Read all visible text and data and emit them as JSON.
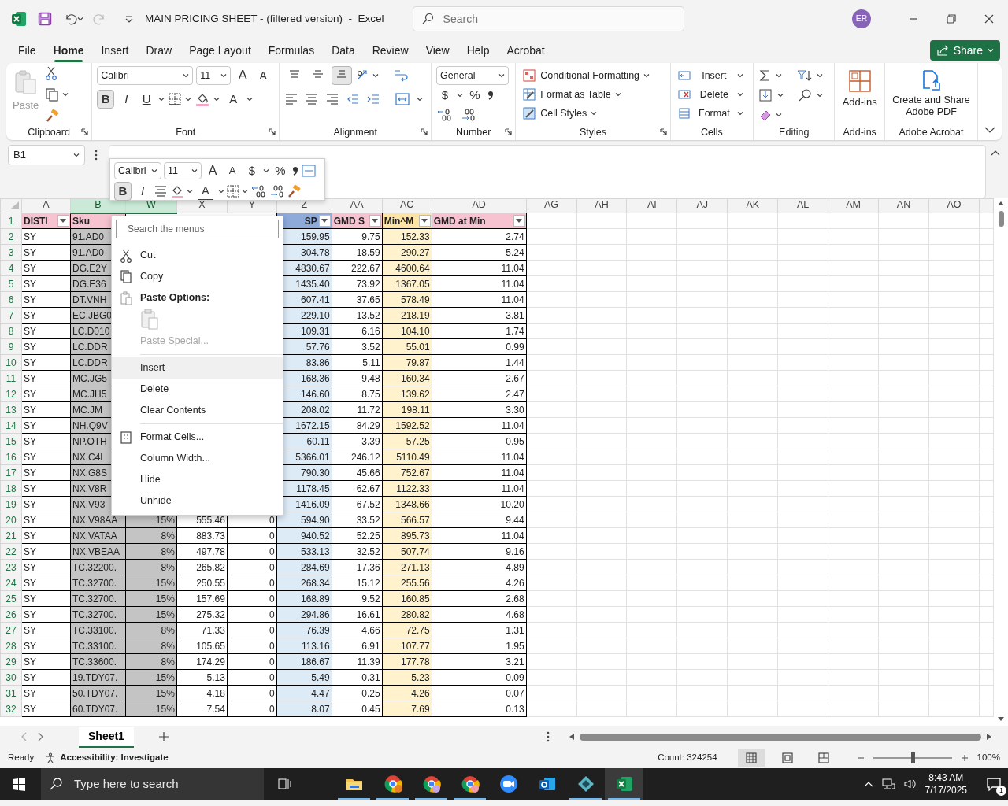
{
  "title_bar": {
    "title": "MAIN PRICING SHEET - (filtered version)  -  Excel",
    "search": {
      "placeholder": "Search"
    },
    "avatar": "ER"
  },
  "ribbon_tabs": [
    {
      "label": "File",
      "selected": false
    },
    {
      "label": "Home",
      "selected": true
    },
    {
      "label": "Insert",
      "selected": false
    },
    {
      "label": "Draw",
      "selected": false
    },
    {
      "label": "Page Layout",
      "selected": false
    },
    {
      "label": "Formulas",
      "selected": false
    },
    {
      "label": "Data",
      "selected": false
    },
    {
      "label": "Review",
      "selected": false
    },
    {
      "label": "View",
      "selected": false
    },
    {
      "label": "Help",
      "selected": false
    },
    {
      "label": "Acrobat",
      "selected": false
    }
  ],
  "share": "Share",
  "ribbon": {
    "clipboard": {
      "label": "Clipboard",
      "paste": "Paste",
      "paste_disabled": true
    },
    "font": {
      "label": "Font",
      "font": "Calibri",
      "size": "11",
      "grow": "A",
      "shrink": "A",
      "styles": [
        {
          "text": "B",
          "selected": true
        },
        {
          "text": "I",
          "selected": false
        },
        {
          "text": "U",
          "selected": false
        }
      ],
      "font_color": "A"
    },
    "alignment": {
      "label": "Alignment",
      "vertical": [
        {
          "selected": false
        },
        {
          "selected": false
        },
        {
          "selected": true
        }
      ]
    },
    "number": {
      "label": "Number",
      "format": "General",
      "currency": "$",
      "percent": "%"
    },
    "styles": {
      "label": "Styles",
      "items": [
        "Conditional Formatting",
        "Format as Table",
        "Cell Styles"
      ]
    },
    "cells": {
      "label": "Cells",
      "items": [
        "Insert",
        "Delete",
        "Format"
      ]
    },
    "editing": {
      "label": "Editing"
    },
    "addins": {
      "label": "Add-ins",
      "button": "Add-ins"
    },
    "acrobat": {
      "label": "Adobe Acrobat",
      "button": "Create and Share Adobe PDF"
    }
  },
  "formula_bar": {
    "name_box": "B1"
  },
  "mini_toolbar": {
    "font": "Calibri",
    "size": "11",
    "grow": "A",
    "shrink": "A",
    "currency": "$",
    "percent": "%",
    "bold": {
      "text": "B",
      "selected": true
    },
    "italic": {
      "text": "I",
      "selected": false
    },
    "font_color": "A"
  },
  "columns": [
    {
      "label": "A",
      "selected": false
    },
    {
      "label": "B",
      "selected": true
    },
    {
      "label": "W",
      "selected": true
    },
    {
      "label": "X",
      "selected": false
    },
    {
      "label": "Y",
      "selected": false
    },
    {
      "label": "Z",
      "selected": false,
      "color": "#ddebf7"
    },
    {
      "label": "AA",
      "selected": false
    },
    {
      "label": "AC",
      "selected": false,
      "color": "#fff2cc"
    },
    {
      "label": "AD",
      "selected": false
    },
    {
      "label": "AG",
      "selected": false
    },
    {
      "label": "AH",
      "selected": false
    },
    {
      "label": "AI",
      "selected": false
    },
    {
      "label": "AJ",
      "selected": false
    },
    {
      "label": "AK",
      "selected": false
    },
    {
      "label": "AL",
      "selected": false
    },
    {
      "label": "AM",
      "selected": false
    },
    {
      "label": "AN",
      "selected": false
    },
    {
      "label": "AO",
      "selected": false
    }
  ],
  "header_row": {
    "number": "1",
    "cells": [
      {
        "text": "DISTI",
        "color": "#f8c3d1",
        "filter": true
      },
      {
        "text": "Sku",
        "color": "#f8c3d1"
      },
      null,
      null,
      null,
      {
        "text": "SP",
        "color": "#8eaadb",
        "filter": true
      },
      {
        "text": "GMD S",
        "color": "#f8c3d1",
        "filter": true
      },
      {
        "text": "Min^M",
        "color": "#fde3a4",
        "filter": true
      },
      {
        "text": "GMD at Min",
        "color": "#f8c3d1",
        "filter": true
      }
    ]
  },
  "rows": [
    {
      "number": "2",
      "cells": [
        "SY",
        "91.AD0",
        null,
        null,
        null,
        "159.95",
        "9.75",
        "152.33",
        "2.74"
      ]
    },
    {
      "number": "3",
      "cells": [
        "SY",
        "91.AD0",
        null,
        null,
        null,
        "304.78",
        "18.59",
        "290.27",
        "5.24"
      ]
    },
    {
      "number": "4",
      "cells": [
        "SY",
        "DG.E2Y",
        null,
        null,
        null,
        "4830.67",
        "222.67",
        "4600.64",
        "11.04"
      ]
    },
    {
      "number": "5",
      "cells": [
        "SY",
        "DG.E36",
        null,
        null,
        null,
        "1435.40",
        "73.92",
        "1367.05",
        "11.04"
      ]
    },
    {
      "number": "6",
      "cells": [
        "SY",
        "DT.VNH",
        null,
        null,
        null,
        "607.41",
        "37.65",
        "578.49",
        "11.04"
      ]
    },
    {
      "number": "7",
      "cells": [
        "SY",
        "EC.JBG0",
        null,
        null,
        null,
        "229.10",
        "13.52",
        "218.19",
        "3.81"
      ]
    },
    {
      "number": "8",
      "cells": [
        "SY",
        "LC.D010",
        null,
        null,
        null,
        "109.31",
        "6.16",
        "104.10",
        "1.74"
      ]
    },
    {
      "number": "9",
      "cells": [
        "SY",
        "LC.DDR",
        null,
        null,
        null,
        "57.76",
        "3.52",
        "55.01",
        "0.99"
      ]
    },
    {
      "number": "10",
      "cells": [
        "SY",
        "LC.DDR",
        null,
        null,
        null,
        "83.86",
        "5.11",
        "79.87",
        "1.44"
      ]
    },
    {
      "number": "11",
      "cells": [
        "SY",
        "MC.JG5",
        null,
        null,
        null,
        "168.36",
        "9.48",
        "160.34",
        "2.67"
      ]
    },
    {
      "number": "12",
      "cells": [
        "SY",
        "MC.JH5",
        null,
        null,
        null,
        "146.60",
        "8.75",
        "139.62",
        "2.47"
      ]
    },
    {
      "number": "13",
      "cells": [
        "SY",
        "MC.JM",
        null,
        null,
        null,
        "208.02",
        "11.72",
        "198.11",
        "3.30"
      ]
    },
    {
      "number": "14",
      "cells": [
        "SY",
        "NH.Q9V",
        null,
        null,
        null,
        "1672.15",
        "84.29",
        "1592.52",
        "11.04"
      ]
    },
    {
      "number": "15",
      "cells": [
        "SY",
        "NP.OTH",
        null,
        null,
        null,
        "60.11",
        "3.39",
        "57.25",
        "0.95"
      ]
    },
    {
      "number": "16",
      "cells": [
        "SY",
        "NX.C4L",
        null,
        null,
        null,
        "5366.01",
        "246.12",
        "5110.49",
        "11.04"
      ]
    },
    {
      "number": "17",
      "cells": [
        "SY",
        "NX.G8S",
        null,
        null,
        null,
        "790.30",
        "45.66",
        "752.67",
        "11.04"
      ]
    },
    {
      "number": "18",
      "cells": [
        "SY",
        "NX.V8R",
        null,
        null,
        null,
        "1178.45",
        "62.67",
        "1122.33",
        "11.04"
      ]
    },
    {
      "number": "19",
      "cells": [
        "SY",
        "NX.V93",
        null,
        null,
        null,
        "1416.09",
        "67.52",
        "1348.66",
        "10.20"
      ]
    },
    {
      "number": "20",
      "cells": [
        "SY",
        "NX.V98AA",
        "15%",
        "555.46",
        "0",
        "594.90",
        "33.52",
        "566.57",
        "9.44"
      ]
    },
    {
      "number": "21",
      "cells": [
        "SY",
        "NX.VATAA",
        "8%",
        "883.73",
        "0",
        "940.52",
        "52.25",
        "895.73",
        "11.04"
      ]
    },
    {
      "number": "22",
      "cells": [
        "SY",
        "NX.VBEAA",
        "8%",
        "497.78",
        "0",
        "533.13",
        "32.52",
        "507.74",
        "9.16"
      ]
    },
    {
      "number": "23",
      "cells": [
        "SY",
        "TC.32200.",
        "8%",
        "265.82",
        "0",
        "284.69",
        "17.36",
        "271.13",
        "4.89"
      ]
    },
    {
      "number": "24",
      "cells": [
        "SY",
        "TC.32700.",
        "15%",
        "250.55",
        "0",
        "268.34",
        "15.12",
        "255.56",
        "4.26"
      ]
    },
    {
      "number": "25",
      "cells": [
        "SY",
        "TC.32700.",
        "15%",
        "157.69",
        "0",
        "168.89",
        "9.52",
        "160.85",
        "2.68"
      ]
    },
    {
      "number": "26",
      "cells": [
        "SY",
        "TC.32700.",
        "15%",
        "275.32",
        "0",
        "294.86",
        "16.61",
        "280.82",
        "4.68"
      ]
    },
    {
      "number": "27",
      "cells": [
        "SY",
        "TC.33100.",
        "8%",
        "71.33",
        "0",
        "76.39",
        "4.66",
        "72.75",
        "1.31"
      ]
    },
    {
      "number": "28",
      "cells": [
        "SY",
        "TC.33100.",
        "8%",
        "105.65",
        "0",
        "113.16",
        "6.91",
        "107.77",
        "1.95"
      ]
    },
    {
      "number": "29",
      "cells": [
        "SY",
        "TC.33600.",
        "8%",
        "174.29",
        "0",
        "186.67",
        "11.39",
        "177.78",
        "3.21"
      ]
    },
    {
      "number": "30",
      "cells": [
        "SY",
        "19.TDY07.",
        "15%",
        "5.13",
        "0",
        "5.49",
        "0.31",
        "5.23",
        "0.09"
      ]
    },
    {
      "number": "31",
      "cells": [
        "SY",
        "50.TDY07.",
        "15%",
        "4.18",
        "0",
        "4.47",
        "0.25",
        "4.26",
        "0.07"
      ]
    },
    {
      "number": "32",
      "cells": [
        "SY",
        "60.TDY07.",
        "15%",
        "7.54",
        "0",
        "8.07",
        "0.45",
        "7.69",
        "0.13"
      ]
    }
  ],
  "context_menu": {
    "search": {
      "placeholder": "Search the menus"
    },
    "items": [
      {
        "kind": "item",
        "label": "Cut",
        "selected": false,
        "disabled": false
      },
      {
        "kind": "item",
        "label": "Copy",
        "selected": false,
        "disabled": false
      },
      {
        "kind": "heading",
        "label": "Paste Options:"
      },
      {
        "kind": "paste",
        "disabled": true
      },
      {
        "kind": "item",
        "label": "Paste Special...",
        "selected": false,
        "disabled": true
      },
      {
        "kind": "separator"
      },
      {
        "kind": "item",
        "label": "Insert",
        "selected": true,
        "disabled": false
      },
      {
        "kind": "item",
        "label": "Delete",
        "selected": false,
        "disabled": false
      },
      {
        "kind": "item",
        "label": "Clear Contents",
        "selected": false,
        "disabled": false
      },
      {
        "kind": "separator"
      },
      {
        "kind": "item",
        "label": "Format Cells...",
        "selected": false,
        "disabled": false
      },
      {
        "kind": "item",
        "label": "Column Width...",
        "selected": false,
        "disabled": false
      },
      {
        "kind": "item",
        "label": "Hide",
        "selected": false,
        "disabled": false
      },
      {
        "kind": "item",
        "label": "Unhide",
        "selected": false,
        "disabled": false
      }
    ]
  },
  "sheet_tabs": [
    {
      "label": "Sheet1",
      "selected": true
    }
  ],
  "status_bar": {
    "mode": "Ready",
    "accessibility": "Accessibility: Investigate",
    "count": "Count: 324254",
    "views": [
      {
        "selected": true
      },
      {
        "selected": false
      },
      {
        "selected": false
      }
    ],
    "zoom": {
      "level": 0.5
    },
    "zoom_reading": "100%"
  },
  "taskbar": {
    "search": {
      "placeholder": "Type here to search"
    },
    "apps": [
      {
        "running": true,
        "selected": false
      },
      {
        "running": true,
        "selected": false
      },
      {
        "running": true,
        "selected": false
      },
      {
        "running": true,
        "selected": false
      },
      {
        "running": false,
        "selected": false
      },
      {
        "running": false,
        "selected": false
      },
      {
        "running": true,
        "selected": false
      },
      {
        "running": true,
        "selected": true
      }
    ],
    "time": "8:43 AM",
    "date": "7/17/2025",
    "notifications": "1"
  }
}
